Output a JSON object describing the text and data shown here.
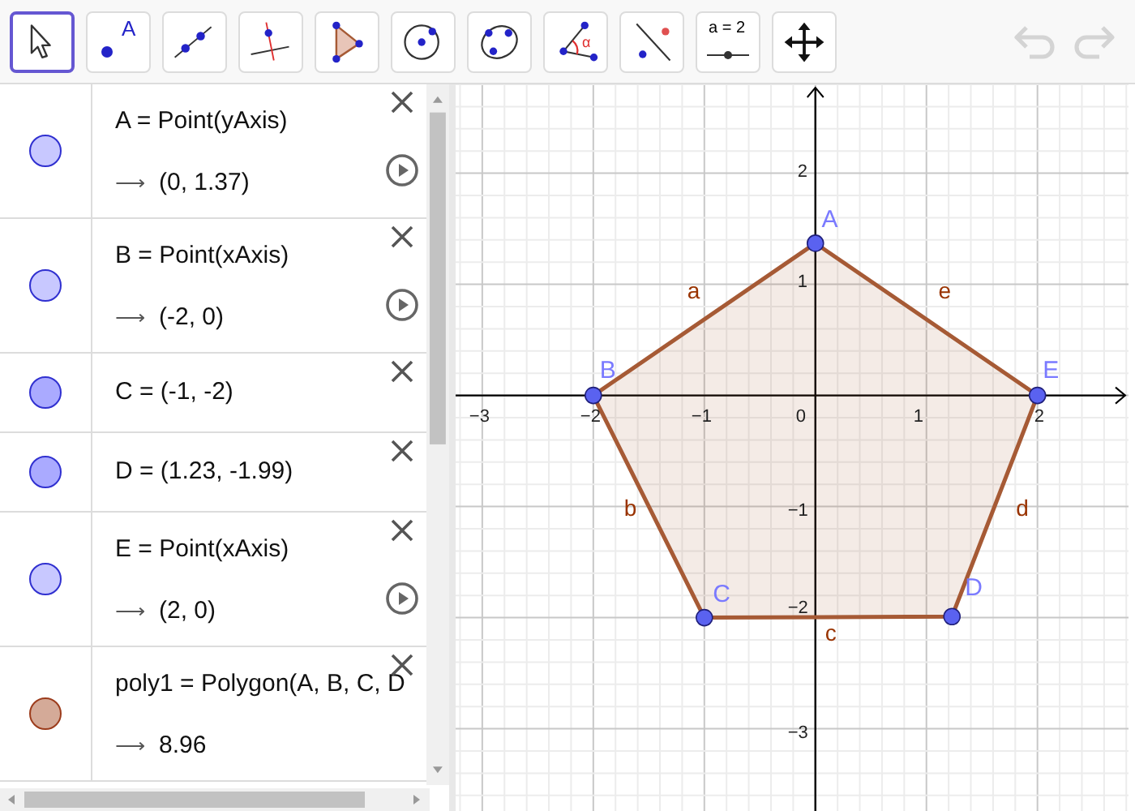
{
  "toolbar": {
    "tools": [
      {
        "kind": "move",
        "selected": true
      },
      {
        "kind": "point",
        "label": "A",
        "selected": false
      },
      {
        "kind": "line",
        "selected": false
      },
      {
        "kind": "perpendicular",
        "selected": false
      },
      {
        "kind": "polygon",
        "selected": false
      },
      {
        "kind": "circle",
        "selected": false
      },
      {
        "kind": "conic",
        "selected": false
      },
      {
        "kind": "angle",
        "label": "α",
        "selected": false
      },
      {
        "kind": "reflect",
        "selected": false
      },
      {
        "kind": "slider",
        "label": "a = 2",
        "selected": false
      },
      {
        "kind": "pan",
        "selected": false
      }
    ],
    "undo": {
      "disabled": true
    },
    "redo": {
      "disabled": true
    }
  },
  "algebra": {
    "items": [
      {
        "kind": "point",
        "color": "#c8c8ff",
        "definition": "A = Point(yAxis)",
        "arrow": "⟶",
        "value": "(0, 1.37)",
        "animatable": true
      },
      {
        "kind": "point",
        "color": "#c8c8ff",
        "definition": "B = Point(xAxis)",
        "arrow": "⟶",
        "value": "(-2, 0)",
        "animatable": true
      },
      {
        "kind": "point",
        "color": "#aaaaff",
        "definition": "C = (-1, -2)",
        "animatable": false
      },
      {
        "kind": "point",
        "color": "#aaaaff",
        "definition": "D = (1.23, -1.99)",
        "animatable": false
      },
      {
        "kind": "point",
        "color": "#c8c8ff",
        "definition": "E = Point(xAxis)",
        "arrow": "⟶",
        "value": "(2, 0)",
        "animatable": true
      },
      {
        "kind": "polygon",
        "color": "#d4aa98",
        "definition": "poly1 = Polygon(A, B, C, D",
        "arrow": "⟶",
        "value": "8.96",
        "animatable": false
      }
    ]
  },
  "graphics": {
    "x_tick_labels": [
      "−3",
      "−2",
      "−1",
      "0",
      "1",
      "2"
    ],
    "y_tick_labels": [
      "2",
      "1",
      "−1",
      "−2",
      "−3"
    ],
    "polygon": {
      "color": "#a65a35"
    },
    "points": [
      {
        "label": "A"
      },
      {
        "label": "B"
      },
      {
        "label": "C"
      },
      {
        "label": "D"
      },
      {
        "label": "E"
      }
    ],
    "segments": [
      {
        "label": "a"
      },
      {
        "label": "e"
      },
      {
        "label": "b"
      },
      {
        "label": "d"
      },
      {
        "label": "c"
      }
    ]
  }
}
